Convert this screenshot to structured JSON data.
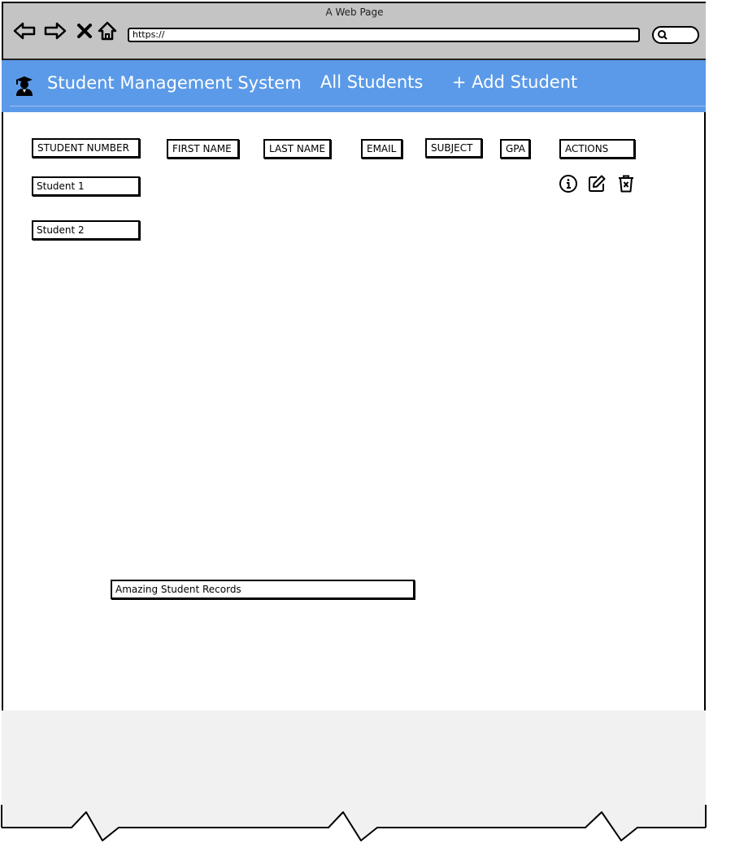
{
  "browser": {
    "window_title": "A Web Page",
    "url": "https://",
    "icons": [
      "back-arrow-icon",
      "forward-arrow-icon",
      "close-x-icon",
      "home-icon",
      "search-icon"
    ]
  },
  "header": {
    "brand_icon": "graduate-icon",
    "title": "Student Management System",
    "nav": [
      {
        "label": "All Students"
      },
      {
        "label": "+ Add Student"
      }
    ],
    "background_color": "#5b9ae8"
  },
  "table": {
    "columns": [
      "STUDENT NUMBER",
      "FIRST NAME",
      "LAST NAME",
      "EMAIL",
      "SUBJECT",
      "GPA",
      "ACTIONS"
    ],
    "rows": [
      {
        "student_number": "Student 1"
      },
      {
        "student_number": "Student 2"
      }
    ],
    "action_icons": [
      "info-icon",
      "edit-icon",
      "delete-icon"
    ]
  },
  "footer": {
    "text": "Amazing Student Records"
  }
}
